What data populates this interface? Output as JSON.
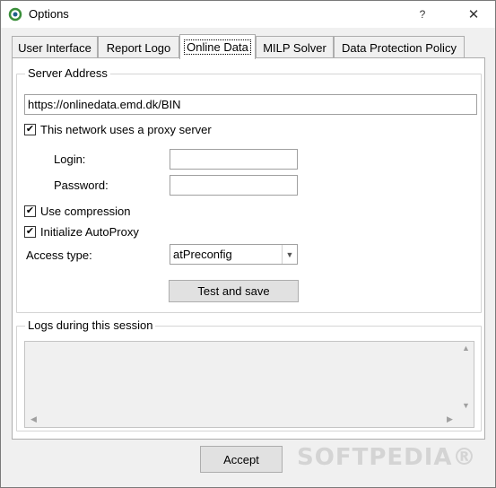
{
  "window": {
    "title": "Options",
    "help_glyph": "?",
    "close_glyph": "✕",
    "app_icon": "app-logo-icon"
  },
  "tabs": [
    {
      "label": "User Interface"
    },
    {
      "label": "Report Logo"
    },
    {
      "label": "Online Data",
      "active": true
    },
    {
      "label": "MILP Solver"
    },
    {
      "label": "Data Protection Policy"
    }
  ],
  "server": {
    "group_label": "Server Address",
    "url": "https://onlinedata.emd.dk/BIN",
    "proxy_label": "This network uses a proxy server",
    "proxy_checked": true,
    "login_label": "Login:",
    "login_value": "",
    "password_label": "Password:",
    "password_value": "",
    "compression_label": "Use compression",
    "compression_checked": true,
    "autoproxy_label": "Initialize AutoProxy",
    "autoproxy_checked": true,
    "access_type_label": "Access type:",
    "access_type_value": "atPreconfig",
    "test_button": "Test and save"
  },
  "logs": {
    "group_label": "Logs during this session"
  },
  "footer": {
    "accept_button": "Accept",
    "watermark": "SOFTPEDIA®"
  },
  "colors": {
    "window_bg": "#f0f0f0",
    "page_bg": "#ffffff",
    "border": "#adadad",
    "icon_green": "#3a8f3a"
  }
}
